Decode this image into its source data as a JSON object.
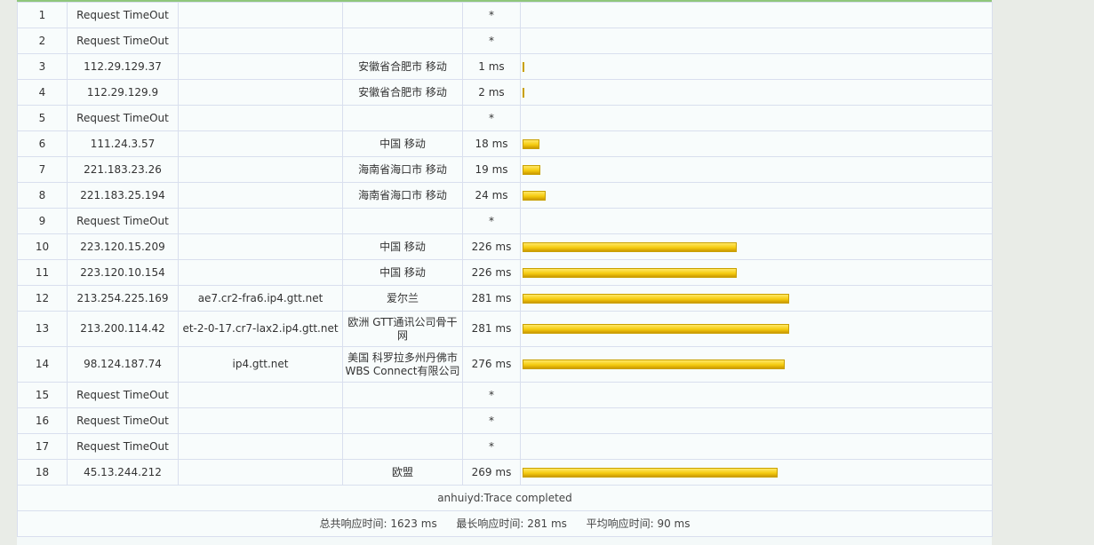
{
  "hops": [
    {
      "hop": "1",
      "ip": "Request TimeOut",
      "host": "",
      "location": "",
      "time": "*",
      "ms": 0
    },
    {
      "hop": "2",
      "ip": "Request TimeOut",
      "host": "",
      "location": "",
      "time": "*",
      "ms": 0
    },
    {
      "hop": "3",
      "ip": "112.29.129.37",
      "host": "",
      "location": "安徽省合肥市 移动",
      "time": "1 ms",
      "ms": 1
    },
    {
      "hop": "4",
      "ip": "112.29.129.9",
      "host": "",
      "location": "安徽省合肥市 移动",
      "time": "2 ms",
      "ms": 2
    },
    {
      "hop": "5",
      "ip": "Request TimeOut",
      "host": "",
      "location": "",
      "time": "*",
      "ms": 0
    },
    {
      "hop": "6",
      "ip": "111.24.3.57",
      "host": "",
      "location": "中国 移动",
      "time": "18 ms",
      "ms": 18
    },
    {
      "hop": "7",
      "ip": "221.183.23.26",
      "host": "",
      "location": "海南省海口市 移动",
      "time": "19 ms",
      "ms": 19
    },
    {
      "hop": "8",
      "ip": "221.183.25.194",
      "host": "",
      "location": "海南省海口市 移动",
      "time": "24 ms",
      "ms": 24
    },
    {
      "hop": "9",
      "ip": "Request TimeOut",
      "host": "",
      "location": "",
      "time": "*",
      "ms": 0
    },
    {
      "hop": "10",
      "ip": "223.120.15.209",
      "host": "",
      "location": "中国 移动",
      "time": "226 ms",
      "ms": 226
    },
    {
      "hop": "11",
      "ip": "223.120.10.154",
      "host": "",
      "location": "中国 移动",
      "time": "226 ms",
      "ms": 226
    },
    {
      "hop": "12",
      "ip": "213.254.225.169",
      "host": "ae7.cr2-fra6.ip4.gtt.net",
      "location": "爱尔兰",
      "time": "281 ms",
      "ms": 281
    },
    {
      "hop": "13",
      "ip": "213.200.114.42",
      "host": "et-2-0-17.cr7-lax2.ip4.gtt.net",
      "location": "欧洲 GTT通讯公司骨干网",
      "time": "281 ms",
      "ms": 281
    },
    {
      "hop": "14",
      "ip": "98.124.187.74",
      "host": "ip4.gtt.net",
      "location": "美国 科罗拉多州丹佛市 WBS Connect有限公司",
      "time": "276 ms",
      "ms": 276
    },
    {
      "hop": "15",
      "ip": "Request TimeOut",
      "host": "",
      "location": "",
      "time": "*",
      "ms": 0
    },
    {
      "hop": "16",
      "ip": "Request TimeOut",
      "host": "",
      "location": "",
      "time": "*",
      "ms": 0
    },
    {
      "hop": "17",
      "ip": "Request TimeOut",
      "host": "",
      "location": "",
      "time": "*",
      "ms": 0
    },
    {
      "hop": "18",
      "ip": "45.13.244.212",
      "host": "",
      "location": "欧盟",
      "time": "269 ms",
      "ms": 269
    }
  ],
  "status": "anhuiyd:Trace completed",
  "summary": {
    "total_label": "总共响应时间:",
    "total_value": "1623 ms",
    "max_label": "最长响应时间:",
    "max_value": "281 ms",
    "avg_label": "平均响应时间:",
    "avg_value": "90 ms"
  },
  "colors": {
    "bar_fill": "#f5cc10",
    "top_accent": "#8fc77b",
    "grid": "#d9dfee"
  }
}
